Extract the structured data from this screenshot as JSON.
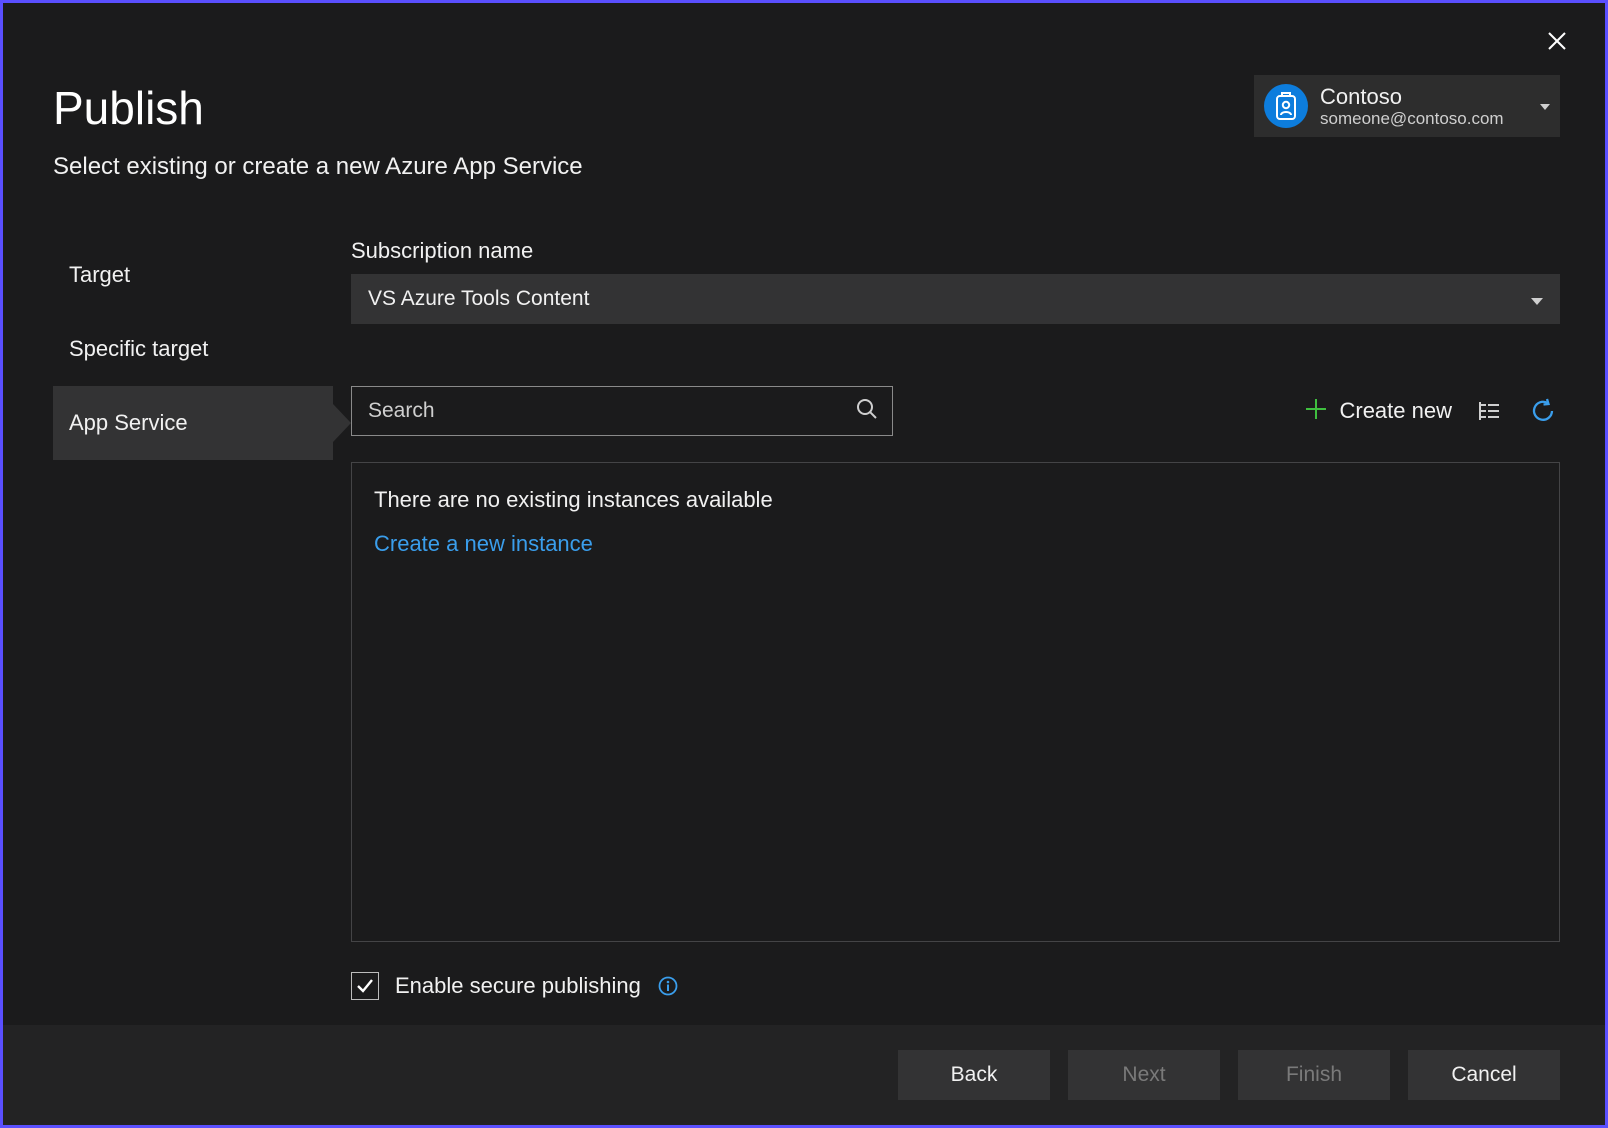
{
  "header": {
    "title": "Publish",
    "subtitle": "Select existing or create a new Azure App Service"
  },
  "account": {
    "org": "Contoso",
    "email": "someone@contoso.com"
  },
  "steps": {
    "target": "Target",
    "specific": "Specific target",
    "appservice": "App Service"
  },
  "subscription": {
    "label": "Subscription name",
    "value": "VS Azure Tools Content"
  },
  "search": {
    "placeholder": "Search"
  },
  "actions": {
    "create_new": "Create new"
  },
  "panel": {
    "empty_message": "There are no existing instances available",
    "create_link": "Create a new instance"
  },
  "secure": {
    "label": "Enable secure publishing",
    "checked": true
  },
  "footer": {
    "back": "Back",
    "next": "Next",
    "finish": "Finish",
    "cancel": "Cancel"
  }
}
